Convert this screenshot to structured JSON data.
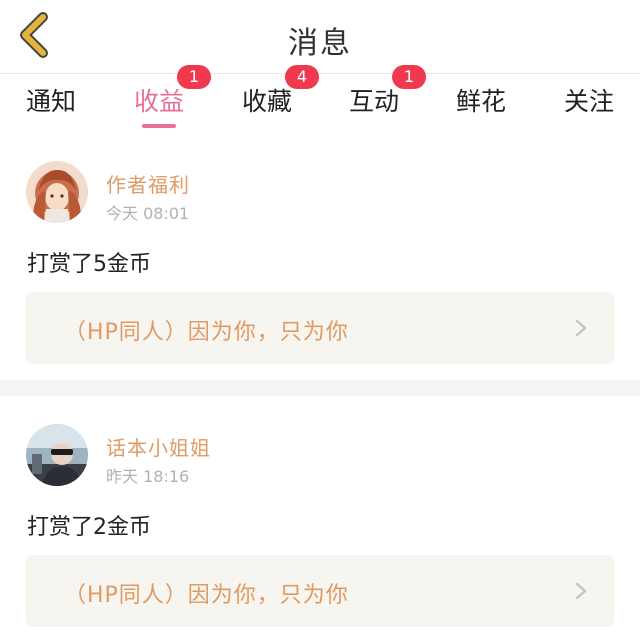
{
  "header": {
    "title": "消息"
  },
  "tabs": [
    {
      "label": "通知",
      "badge": null,
      "active": false
    },
    {
      "label": "收益",
      "badge": "1",
      "active": true
    },
    {
      "label": "收藏",
      "badge": "4",
      "active": false
    },
    {
      "label": "互动",
      "badge": "1",
      "active": false
    },
    {
      "label": "鲜花",
      "badge": null,
      "active": false
    },
    {
      "label": "关注",
      "badge": null,
      "active": false
    }
  ],
  "messages": [
    {
      "sender": "作者福利",
      "time": "今天 08:01",
      "text": "打赏了5金币",
      "work_title": "（HP同人）因为你，只为你",
      "avatar": "anime-girl-avatar"
    },
    {
      "sender": "话本小姐姐",
      "time": "昨天 18:16",
      "text": "打赏了2金币",
      "work_title": "（HP同人）因为你，只为你",
      "avatar": "photo-avatar"
    }
  ],
  "colors": {
    "accent": "#e86f9a",
    "badge": "#f0394e",
    "sender": "#e09a63",
    "back_icon": "#e6b43c",
    "link_bg": "#f6f5ef"
  },
  "icons": {
    "back": "back-chevron-icon",
    "go": "chevron-right-icon"
  }
}
